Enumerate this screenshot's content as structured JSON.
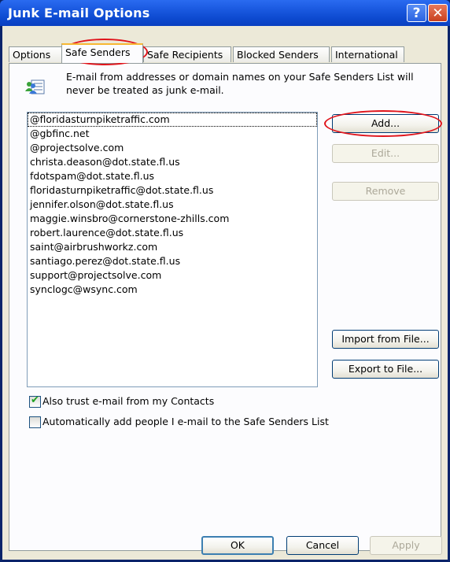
{
  "window": {
    "title": "Junk E-mail Options",
    "help_label": "?",
    "close_label": "✕"
  },
  "tabs": [
    {
      "label": "Options"
    },
    {
      "label": "Safe Senders"
    },
    {
      "label": "Safe Recipients"
    },
    {
      "label": "Blocked Senders"
    },
    {
      "label": "International"
    }
  ],
  "active_tab": "Safe Senders",
  "info": {
    "icon": "people-list-icon",
    "text": "E-mail from addresses or domain names on your Safe Senders List will never be treated as junk e-mail."
  },
  "senders": [
    "@floridasturnpiketraffic.com",
    "@gbfinc.net",
    "@projectsolve.com",
    "christa.deason@dot.state.fl.us",
    "fdotspam@dot.state.fl.us",
    "floridasturnpiketraffic@dot.state.fl.us",
    "jennifer.olson@dot.state.fl.us",
    "maggie.winsbro@cornerstone-zhills.com",
    "robert.laurence@dot.state.fl.us",
    "saint@airbrushworkz.com",
    "santiago.perez@dot.state.fl.us",
    "support@projectsolve.com",
    "synclogc@wsync.com"
  ],
  "buttons": {
    "add": "Add...",
    "edit": "Edit...",
    "remove": "Remove",
    "import": "Import from File...",
    "export": "Export to File..."
  },
  "options": {
    "trust_contacts": {
      "label": "Also trust e-mail from my Contacts",
      "checked": true
    },
    "auto_add": {
      "label": "Automatically add people I e-mail to the Safe Senders List",
      "checked": false
    }
  },
  "footer": {
    "ok": "OK",
    "cancel": "Cancel",
    "apply": "Apply"
  },
  "colors": {
    "annotation": "#e0141b",
    "titlebar": "#0a40c0",
    "dialog": "#ece9d8"
  }
}
